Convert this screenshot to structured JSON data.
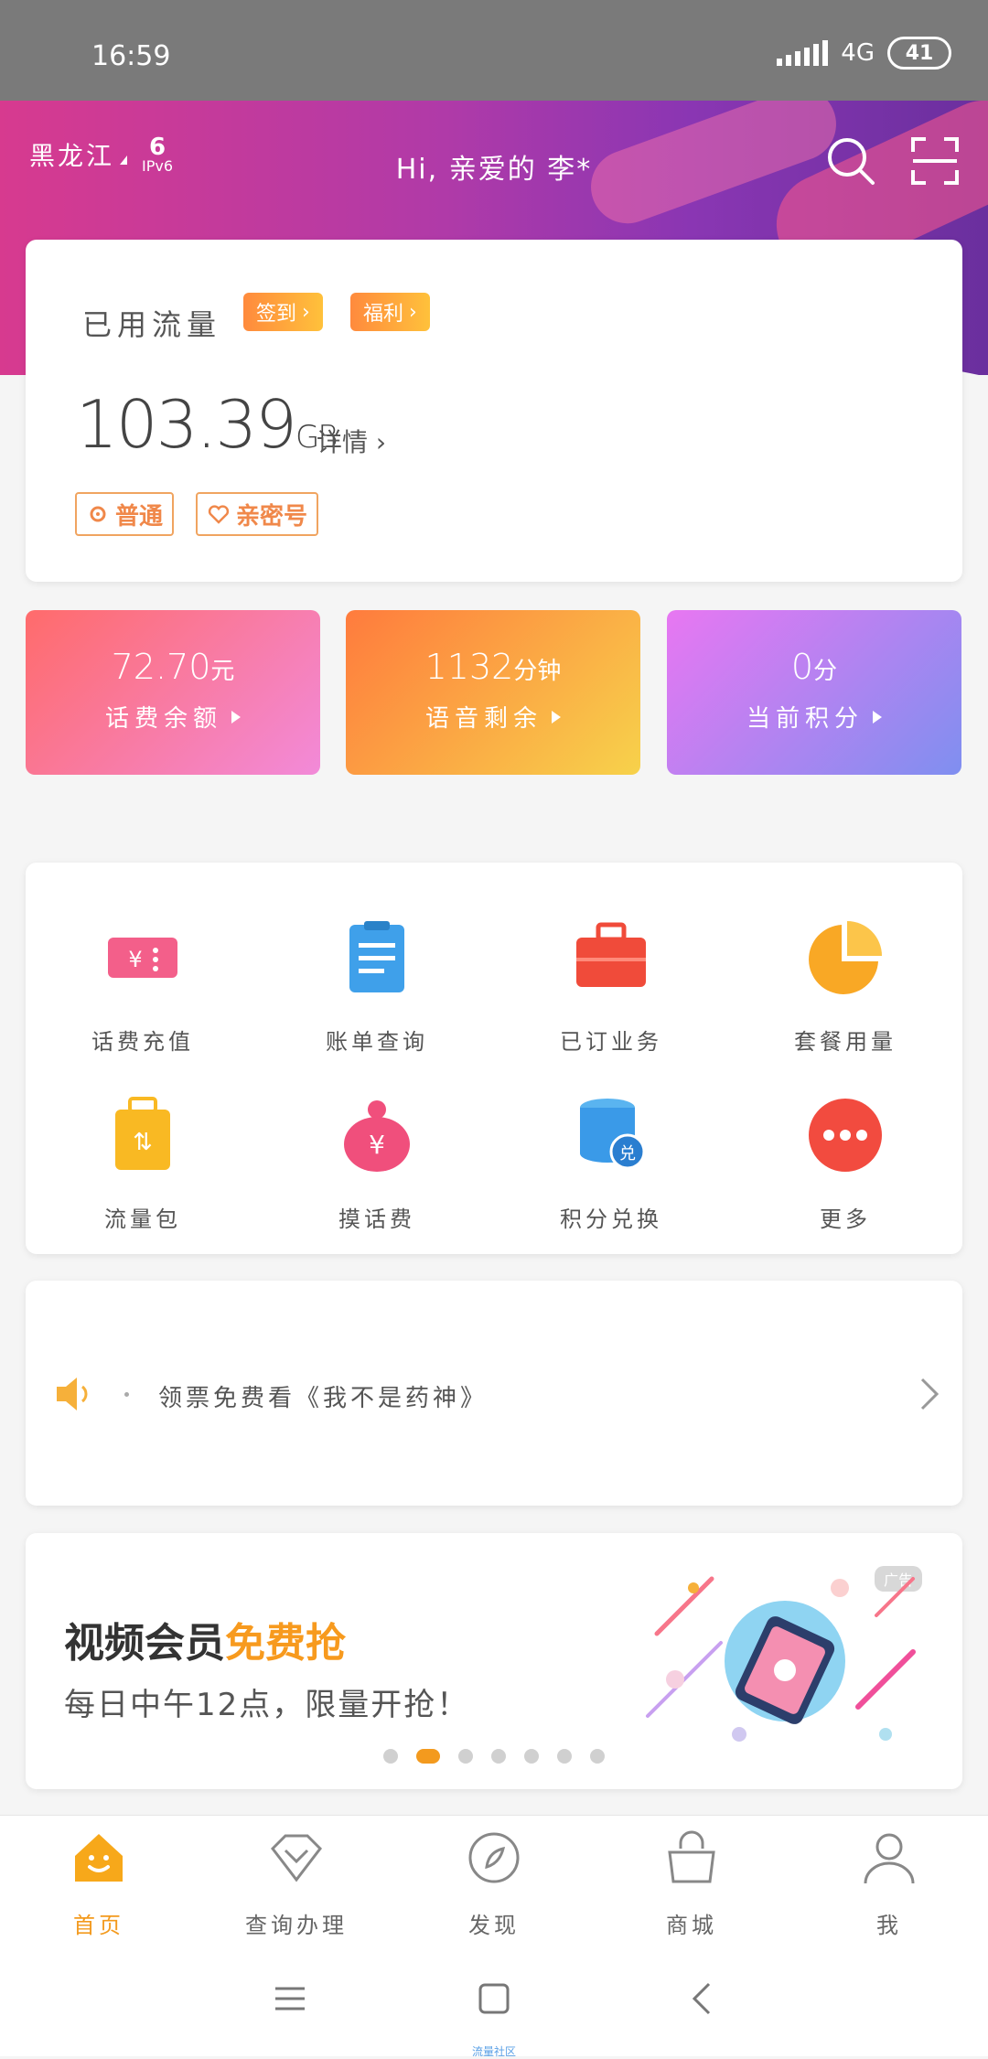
{
  "status_bar": {
    "time": "16:59",
    "network": "4G",
    "battery": "41"
  },
  "header": {
    "region": "黑龙江",
    "ipv6_label": "IPv6",
    "greeting": "Hi, 亲爱的 李*"
  },
  "usage": {
    "title": "已用流量",
    "signin_label": "签到",
    "welfare_label": "福利",
    "value": "103.39",
    "unit": "GB",
    "detail_label": "详情",
    "tags": [
      "普通",
      "亲密号"
    ]
  },
  "stats": [
    {
      "value": "72.70",
      "unit": "元",
      "label": "话费余额"
    },
    {
      "value": "1132",
      "unit": "分钟",
      "label": "语音剩余"
    },
    {
      "value": "0",
      "unit": "分",
      "label": "当前积分"
    }
  ],
  "services": [
    {
      "label": "话费充值",
      "icon": "recharge-ticket-icon",
      "color": "#f35f8a"
    },
    {
      "label": "账单查询",
      "icon": "bill-clipboard-icon",
      "color": "#3fa0ea"
    },
    {
      "label": "已订业务",
      "icon": "briefcase-icon",
      "color": "#f04b3a"
    },
    {
      "label": "套餐用量",
      "icon": "pie-chart-icon",
      "color": "#f9a825"
    },
    {
      "label": "流量包",
      "icon": "data-bag-icon",
      "color": "#f9b923"
    },
    {
      "label": "摸话费",
      "icon": "money-bag-icon",
      "color": "#f04f7c"
    },
    {
      "label": "积分兑换",
      "icon": "points-database-icon",
      "color": "#3a9ae8"
    },
    {
      "label": "更多",
      "icon": "more-dots-icon",
      "color": "#f24b3f"
    }
  ],
  "notice": {
    "text": "领票免费看《我不是药神》"
  },
  "ad": {
    "title_main": "视频会员",
    "title_highlight": "免费抢",
    "subtitle": "每日中午12点，限量开抢！",
    "badge": "广告",
    "slide_count": 7,
    "active_slide": 2
  },
  "tabs": [
    {
      "label": "首页",
      "icon": "home-icon",
      "active": true
    },
    {
      "label": "查询办理",
      "icon": "diamond-icon",
      "active": false
    },
    {
      "label": "发现",
      "icon": "compass-icon",
      "active": false
    },
    {
      "label": "商城",
      "icon": "shopping-bag-icon",
      "active": false
    },
    {
      "label": "我",
      "icon": "person-icon",
      "active": false
    }
  ],
  "nav_caption": "流量社区",
  "colors": {
    "accent": "#f39a1e",
    "header_start": "#d73a8f",
    "header_end": "#6a2f9e"
  }
}
